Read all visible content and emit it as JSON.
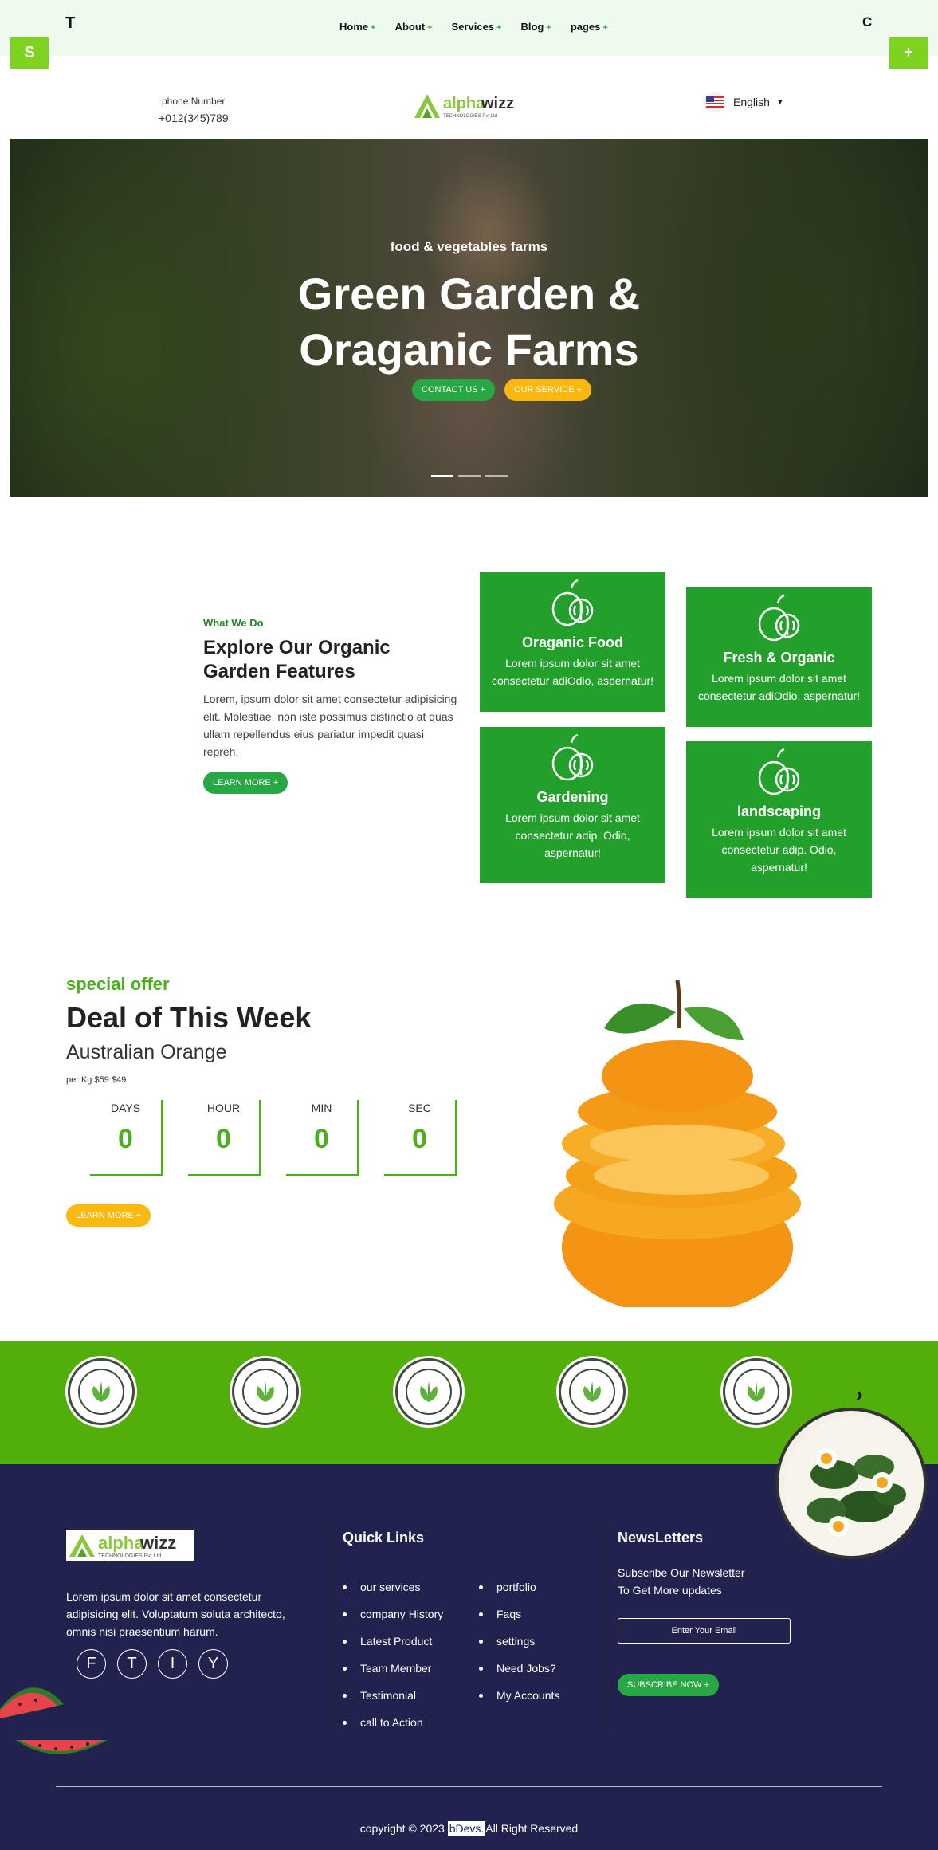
{
  "topnav": {
    "left_letter": "T",
    "right_letter": "C",
    "items": [
      {
        "label": "Home",
        "icon": "+"
      },
      {
        "label": "About",
        "icon": "+"
      },
      {
        "label": "Services",
        "icon": "+"
      },
      {
        "label": "Blog",
        "icon": "+"
      },
      {
        "label": "pages",
        "icon": "+"
      }
    ],
    "left_square": "S",
    "right_square": "+"
  },
  "header": {
    "phone_label": "phone Number",
    "phone_number": "+012(345)789",
    "logo_alpha": "alpha",
    "logo_wizz": "wizz",
    "logo_sub": "TECHNOLOGIES Pvt Ltd",
    "language": "English"
  },
  "hero": {
    "subtitle": "food & vegetables farms",
    "title_line1": "Green Garden &",
    "title_line2": "Oraganic Farms",
    "contact_btn": "CONTACT US +",
    "service_btn": "OUR SERVICE +"
  },
  "what_we_do": {
    "label": "What We Do",
    "title": "Explore Our Organic Garden Features",
    "text": "Lorem, ipsum dolor sit amet consectetur adipisicing elit. Molestiae, non iste possimus distinctio at quas ullam repellendus eius pariatur impedit quasi repreh.",
    "button": "LEARN MORE +",
    "cards": [
      {
        "title": "Oraganic Food",
        "text": "Lorem ipsum dolor sit amet consectetur adiOdio, aspernatur!"
      },
      {
        "title": "Fresh & Organic",
        "text": "Lorem ipsum dolor sit amet consectetur adiOdio, aspernatur!"
      },
      {
        "title": "Gardening",
        "text": "Lorem ipsum dolor sit amet consectetur adip. Odio, aspernatur!"
      },
      {
        "title": "landscaping",
        "text": "Lorem ipsum dolor sit amet consectetur adip. Odio, aspernatur!"
      }
    ]
  },
  "deal": {
    "special": "special offer",
    "title": "Deal of This Week",
    "product": "Australian Orange",
    "price": "per Kg $59 $49",
    "countdown": [
      {
        "label": "DAYS",
        "value": "0"
      },
      {
        "label": "HOUR",
        "value": "0"
      },
      {
        "label": "MIN",
        "value": "0"
      },
      {
        "label": "SEC",
        "value": "0"
      }
    ],
    "button": "LEARN MORE +"
  },
  "band": {
    "prev_icon": "‹",
    "next_icon": "›"
  },
  "footer": {
    "logo_alpha": "alpha",
    "logo_wizz": "wizz",
    "logo_sub": "TECHNOLOGIES Pvt Ltd",
    "about": "Lorem ipsum dolor sit amet consectetur adipisicing elit. Voluptatum soluta architecto, omnis nisi praesentium harum.",
    "socials": [
      "F",
      "T",
      "I",
      "Y"
    ],
    "quick_links_title": "Quick Links",
    "links_col1": [
      "our services",
      "company History",
      "Latest Product",
      "Team Member",
      "Testimonial",
      "call to Action"
    ],
    "links_col2": [
      "portfolio",
      "Faqs",
      "settings",
      "Need Jobs?",
      "My Accounts"
    ],
    "newsletter_title": "NewsLetters",
    "newsletter_line1": "Subscribe Our Newsletter",
    "newsletter_line2": "To Get More updates",
    "email_placeholder": "Enter Your Email",
    "subscribe_btn": "SUBSCRIBE NOW +",
    "copyright_pre": "copyright © 2023",
    "copyright_brand": "bDevs.",
    "copyright_post": "All Right Reserved"
  },
  "colors": {
    "accent_green": "#23a02b",
    "band_green": "#52ae0a",
    "footer_navy": "#22224f",
    "yellow": "#fbb80f"
  }
}
